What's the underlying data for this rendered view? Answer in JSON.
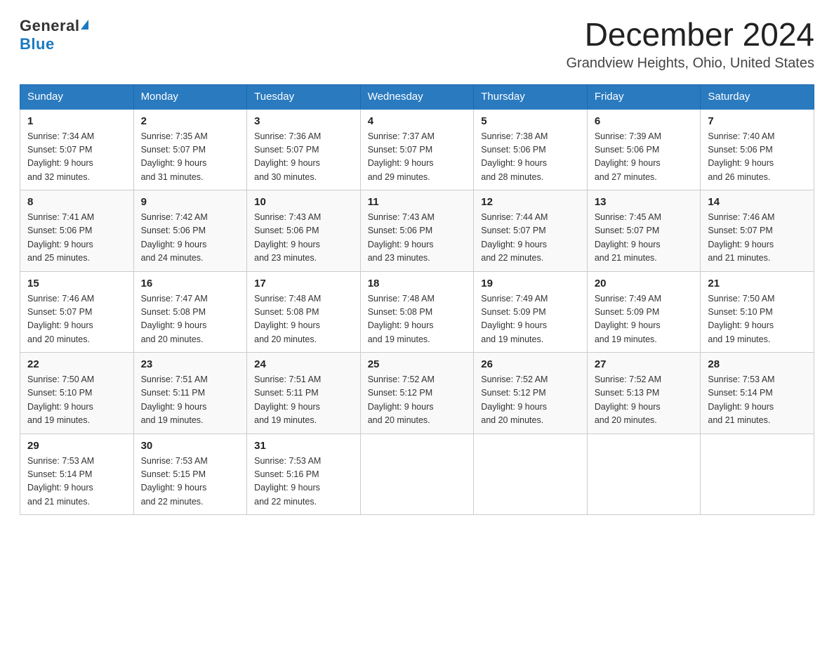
{
  "header": {
    "logo_general": "General",
    "logo_blue": "Blue",
    "title": "December 2024",
    "subtitle": "Grandview Heights, Ohio, United States"
  },
  "weekdays": [
    "Sunday",
    "Monday",
    "Tuesday",
    "Wednesday",
    "Thursday",
    "Friday",
    "Saturday"
  ],
  "weeks": [
    [
      {
        "day": "1",
        "sunrise": "7:34 AM",
        "sunset": "5:07 PM",
        "daylight": "9 hours and 32 minutes."
      },
      {
        "day": "2",
        "sunrise": "7:35 AM",
        "sunset": "5:07 PM",
        "daylight": "9 hours and 31 minutes."
      },
      {
        "day": "3",
        "sunrise": "7:36 AM",
        "sunset": "5:07 PM",
        "daylight": "9 hours and 30 minutes."
      },
      {
        "day": "4",
        "sunrise": "7:37 AM",
        "sunset": "5:07 PM",
        "daylight": "9 hours and 29 minutes."
      },
      {
        "day": "5",
        "sunrise": "7:38 AM",
        "sunset": "5:06 PM",
        "daylight": "9 hours and 28 minutes."
      },
      {
        "day": "6",
        "sunrise": "7:39 AM",
        "sunset": "5:06 PM",
        "daylight": "9 hours and 27 minutes."
      },
      {
        "day": "7",
        "sunrise": "7:40 AM",
        "sunset": "5:06 PM",
        "daylight": "9 hours and 26 minutes."
      }
    ],
    [
      {
        "day": "8",
        "sunrise": "7:41 AM",
        "sunset": "5:06 PM",
        "daylight": "9 hours and 25 minutes."
      },
      {
        "day": "9",
        "sunrise": "7:42 AM",
        "sunset": "5:06 PM",
        "daylight": "9 hours and 24 minutes."
      },
      {
        "day": "10",
        "sunrise": "7:43 AM",
        "sunset": "5:06 PM",
        "daylight": "9 hours and 23 minutes."
      },
      {
        "day": "11",
        "sunrise": "7:43 AM",
        "sunset": "5:06 PM",
        "daylight": "9 hours and 23 minutes."
      },
      {
        "day": "12",
        "sunrise": "7:44 AM",
        "sunset": "5:07 PM",
        "daylight": "9 hours and 22 minutes."
      },
      {
        "day": "13",
        "sunrise": "7:45 AM",
        "sunset": "5:07 PM",
        "daylight": "9 hours and 21 minutes."
      },
      {
        "day": "14",
        "sunrise": "7:46 AM",
        "sunset": "5:07 PM",
        "daylight": "9 hours and 21 minutes."
      }
    ],
    [
      {
        "day": "15",
        "sunrise": "7:46 AM",
        "sunset": "5:07 PM",
        "daylight": "9 hours and 20 minutes."
      },
      {
        "day": "16",
        "sunrise": "7:47 AM",
        "sunset": "5:08 PM",
        "daylight": "9 hours and 20 minutes."
      },
      {
        "day": "17",
        "sunrise": "7:48 AM",
        "sunset": "5:08 PM",
        "daylight": "9 hours and 20 minutes."
      },
      {
        "day": "18",
        "sunrise": "7:48 AM",
        "sunset": "5:08 PM",
        "daylight": "9 hours and 19 minutes."
      },
      {
        "day": "19",
        "sunrise": "7:49 AM",
        "sunset": "5:09 PM",
        "daylight": "9 hours and 19 minutes."
      },
      {
        "day": "20",
        "sunrise": "7:49 AM",
        "sunset": "5:09 PM",
        "daylight": "9 hours and 19 minutes."
      },
      {
        "day": "21",
        "sunrise": "7:50 AM",
        "sunset": "5:10 PM",
        "daylight": "9 hours and 19 minutes."
      }
    ],
    [
      {
        "day": "22",
        "sunrise": "7:50 AM",
        "sunset": "5:10 PM",
        "daylight": "9 hours and 19 minutes."
      },
      {
        "day": "23",
        "sunrise": "7:51 AM",
        "sunset": "5:11 PM",
        "daylight": "9 hours and 19 minutes."
      },
      {
        "day": "24",
        "sunrise": "7:51 AM",
        "sunset": "5:11 PM",
        "daylight": "9 hours and 19 minutes."
      },
      {
        "day": "25",
        "sunrise": "7:52 AM",
        "sunset": "5:12 PM",
        "daylight": "9 hours and 20 minutes."
      },
      {
        "day": "26",
        "sunrise": "7:52 AM",
        "sunset": "5:12 PM",
        "daylight": "9 hours and 20 minutes."
      },
      {
        "day": "27",
        "sunrise": "7:52 AM",
        "sunset": "5:13 PM",
        "daylight": "9 hours and 20 minutes."
      },
      {
        "day": "28",
        "sunrise": "7:53 AM",
        "sunset": "5:14 PM",
        "daylight": "9 hours and 21 minutes."
      }
    ],
    [
      {
        "day": "29",
        "sunrise": "7:53 AM",
        "sunset": "5:14 PM",
        "daylight": "9 hours and 21 minutes."
      },
      {
        "day": "30",
        "sunrise": "7:53 AM",
        "sunset": "5:15 PM",
        "daylight": "9 hours and 22 minutes."
      },
      {
        "day": "31",
        "sunrise": "7:53 AM",
        "sunset": "5:16 PM",
        "daylight": "9 hours and 22 minutes."
      },
      null,
      null,
      null,
      null
    ]
  ]
}
